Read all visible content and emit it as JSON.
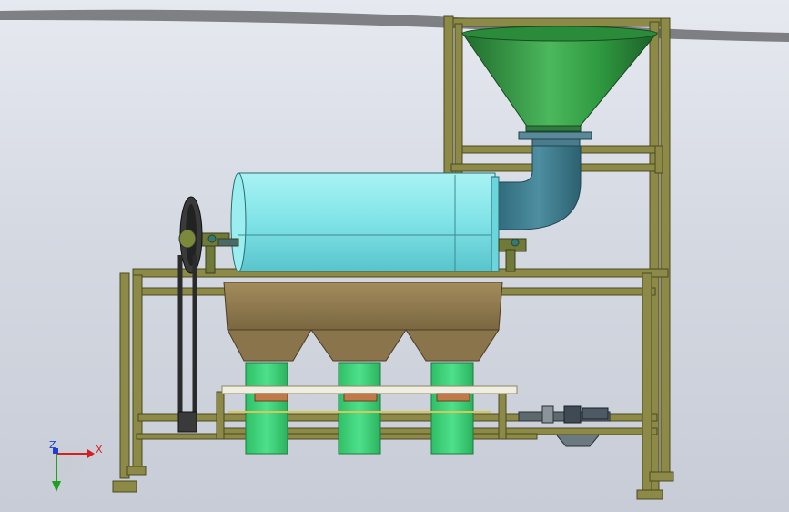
{
  "triad": {
    "x_label": "X",
    "y_label": "Y",
    "z_label": "Z",
    "x_color": "#d32020",
    "y_color": "#1fa01f",
    "z_color": "#1f3fd0"
  },
  "colors": {
    "frame": "#8c8a46",
    "frame_dark": "#5d5b2c",
    "hopper": "#2e8b3e",
    "drum": "#7fe6ea",
    "duct": "#3f7f90",
    "trough": "#8f7a4f",
    "chute": "#3fd07a",
    "belt": "#2b2b2b"
  }
}
